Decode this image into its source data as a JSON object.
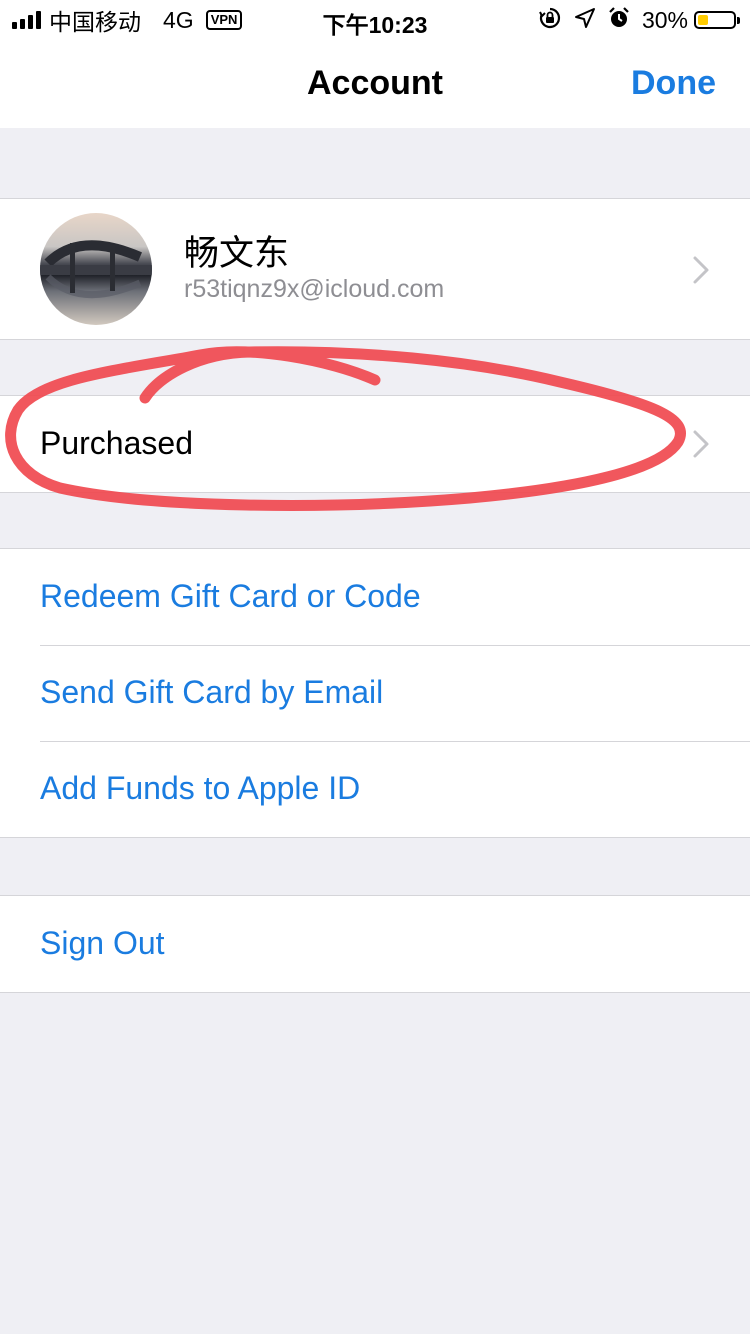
{
  "status_bar": {
    "carrier": "中国移动",
    "network": "4G",
    "vpn": "VPN",
    "time": "下午10:23",
    "battery_percent": "30%",
    "battery_level": 0.3,
    "icons": [
      "signal-bars-icon",
      "orientation-lock-icon",
      "location-arrow-icon",
      "alarm-icon",
      "battery-icon"
    ]
  },
  "nav": {
    "title": "Account",
    "done_label": "Done"
  },
  "profile": {
    "name": "畅文东",
    "email": "r53tiqnz9x@icloud.com"
  },
  "purchased": {
    "label": "Purchased"
  },
  "gift_actions": [
    {
      "label": "Redeem Gift Card or Code"
    },
    {
      "label": "Send Gift Card by Email"
    },
    {
      "label": "Add Funds to Apple ID"
    }
  ],
  "sign_out": {
    "label": "Sign Out"
  },
  "colors": {
    "accent": "#1a7ce0",
    "background": "#efeff4",
    "annotation": "#f0494f",
    "battery_fill": "#ffcc00"
  }
}
